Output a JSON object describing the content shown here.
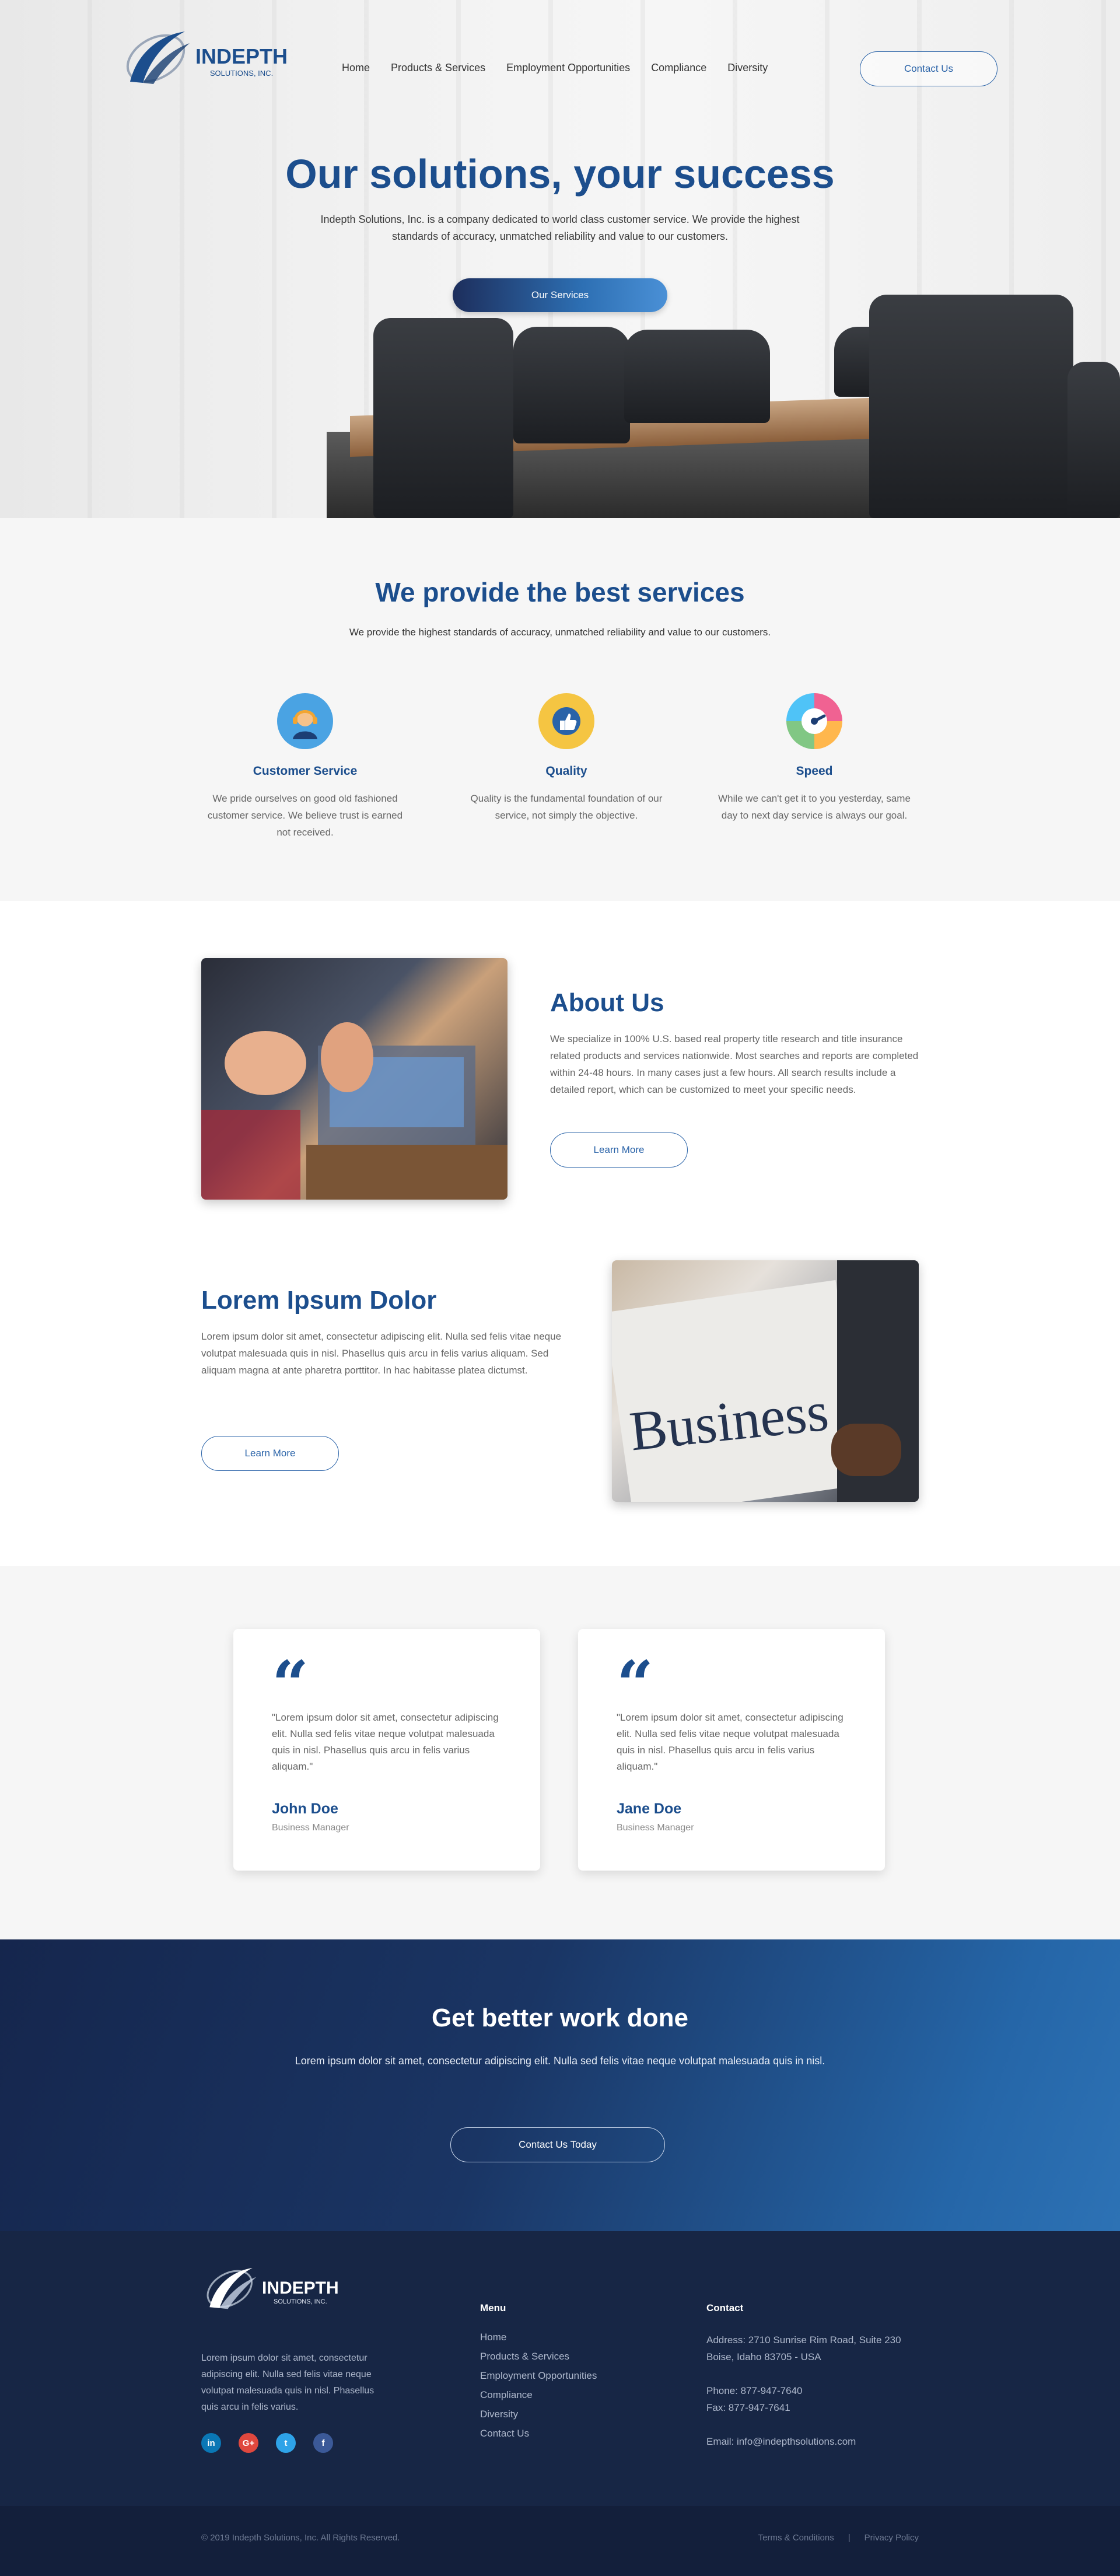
{
  "brand": {
    "name": "INDEPTH",
    "sub": "SOLUTIONS, INC.",
    "colors": {
      "primary": "#1c4e8d",
      "accent": "#2a63a8",
      "dark": "#172645"
    }
  },
  "nav": {
    "items": [
      "Home",
      "Products & Services",
      "Employment Opportunities",
      "Compliance",
      "Diversity"
    ],
    "contact_label": "Contact Us"
  },
  "hero": {
    "title": "Our solutions, your success",
    "description": "Indepth Solutions, Inc. is a company dedicated to world class customer service. We provide the highest standards of accuracy, unmatched reliability and value to our customers.",
    "button": "Our Services"
  },
  "services": {
    "title": "We provide the best services",
    "subtitle": "We provide the highest standards of accuracy, unmatched reliability and value to our customers.",
    "items": [
      {
        "icon": "headset-agent-icon",
        "title": "Customer Service",
        "desc": "We pride ourselves on good old fashioned customer service. We believe trust is earned not received."
      },
      {
        "icon": "thumbs-up-badge-icon",
        "title": "Quality",
        "desc": "Quality is the fundamental foundation of our service, not simply the objective."
      },
      {
        "icon": "speedometer-icon",
        "title": "Speed",
        "desc": "While we can't get it to you yesterday, same day to next day service is always our goal."
      }
    ]
  },
  "about": {
    "title": "About Us",
    "text": "We specialize in 100% U.S. based real property title research and title insurance related products and services nationwide. Most searches and reports are completed within 24-48 hours.  In many cases just a few hours. All search results include a detailed report, which can be customized to meet your specific needs.",
    "button": "Learn More"
  },
  "lorem": {
    "title": "Lorem Ipsum Dolor",
    "text": "Lorem ipsum dolor sit amet, consectetur adipiscing elit. Nulla sed felis vitae neque volutpat malesuada quis in nisl. Phasellus quis arcu in felis varius aliquam. Sed aliquam magna at ante pharetra porttitor. In hac habitasse platea dictumst.",
    "button": "Learn More",
    "photo_text": "Business"
  },
  "testimonials": [
    {
      "quote": "\"Lorem ipsum dolor sit amet, consectetur adipiscing elit. Nulla sed felis vitae neque volutpat malesuada quis in nisl. Phasellus quis arcu in felis varius aliquam.\"",
      "name": "John Doe",
      "role": "Business Manager"
    },
    {
      "quote": "\"Lorem ipsum dolor sit amet, consectetur adipiscing elit. Nulla sed felis vitae neque volutpat malesuada quis in nisl. Phasellus quis arcu in felis varius aliquam.\"",
      "name": "Jane Doe",
      "role": "Business Manager"
    }
  ],
  "cta": {
    "title": "Get better work done",
    "subtitle": "Lorem ipsum dolor sit amet, consectetur adipiscing elit. Nulla sed felis vitae neque volutpat malesuada quis in nisl.",
    "button": "Contact Us Today"
  },
  "footer": {
    "description": "Lorem ipsum dolor sit amet, consectetur adipiscing elit. Nulla sed felis vitae neque volutpat malesuada quis in nisl. Phasellus quis arcu in felis varius.",
    "menu_title": "Menu",
    "menu": [
      "Home",
      "Products & Services",
      "Employment Opportunities",
      "Compliance",
      "Diversity",
      "Contact Us"
    ],
    "contact_title": "Contact",
    "address_line1": "Address: 2710 Sunrise Rim Road, Suite 230",
    "address_line2": "Boise, Idaho 83705 - USA",
    "phone": "Phone: 877-947-7640",
    "fax": "Fax: 877-947-7641",
    "email": "Email: info@indepthsolutions.com",
    "socials": [
      {
        "icon": "linkedin-icon",
        "glyph": "in",
        "color": "#0a77b5"
      },
      {
        "icon": "google-plus-icon",
        "glyph": "G+",
        "color": "#e0483e"
      },
      {
        "icon": "twitter-icon",
        "glyph": "t",
        "color": "#2ea3e8"
      },
      {
        "icon": "facebook-icon",
        "glyph": "f",
        "color": "#3b5998"
      }
    ],
    "copyright": "© 2019 Indepth Solutions, Inc. All Rights Reserved.",
    "terms": "Terms & Conditions",
    "separator": "|",
    "privacy": "Privacy Policy"
  }
}
